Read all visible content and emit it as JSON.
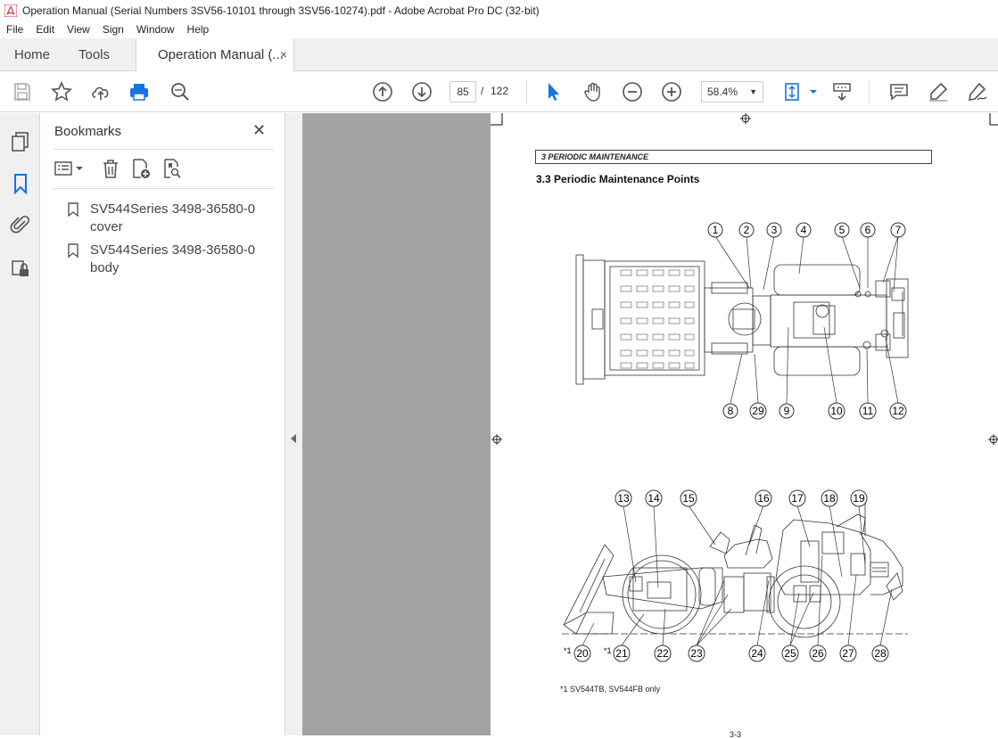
{
  "window": {
    "title": "Operation Manual (Serial Numbers 3SV56-10101 through 3SV56-10274).pdf - Adobe Acrobat Pro DC (32-bit)"
  },
  "menu": [
    "File",
    "Edit",
    "View",
    "Sign",
    "Window",
    "Help"
  ],
  "tabs": {
    "home": "Home",
    "tools": "Tools",
    "document": "Operation Manual (...",
    "close": "×"
  },
  "toolbar": {
    "page_current": "85",
    "page_sep": "/",
    "page_total": "122",
    "zoom": "58.4%"
  },
  "bookmarks": {
    "title": "Bookmarks",
    "close": "✕",
    "items": [
      {
        "label": "SV544Series 3498-36580-0 cover"
      },
      {
        "label": "SV544Series 3498-36580-0 body"
      }
    ]
  },
  "document": {
    "chapter_header": "3  PERIODIC MAINTENANCE",
    "section_title": "3.3  Periodic Maintenance Points",
    "top_callouts": [
      "1",
      "2",
      "3",
      "4",
      "5",
      "6",
      "7",
      "8",
      "29",
      "9",
      "10",
      "11",
      "12"
    ],
    "bottom_callouts": [
      "13",
      "14",
      "15",
      "16",
      "17",
      "18",
      "19",
      "20",
      "21",
      "22",
      "23",
      "24",
      "25",
      "26",
      "27",
      "28"
    ],
    "asterisk_marks": [
      "*1",
      "*1"
    ],
    "footnote": "*1 SV544TB, SV544FB only",
    "page_number": "3-3"
  },
  "colors": {
    "accent": "#1473e6",
    "chrome": "#f0f0f0",
    "viewer_bg": "#a3a3a3"
  }
}
